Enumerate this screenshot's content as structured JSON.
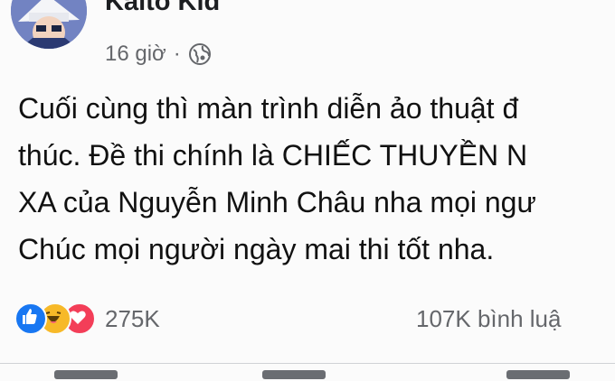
{
  "post": {
    "author": "Kaito Kid",
    "time": "16 giờ",
    "separator": "·",
    "privacy_icon": "globe-icon",
    "text_lines": [
      "Cuối cùng thì màn trình diễn ảo thuật đ",
      "thúc. Đề thi chính là CHIẾC THUYỀN N",
      "XA của Nguyễn Minh Châu nha mọi ngư",
      "Chúc mọi người ngày mai thi tốt nha."
    ]
  },
  "reactions": {
    "icons": [
      "like-icon",
      "haha-icon",
      "love-icon"
    ],
    "count": "275K"
  },
  "comments": {
    "label": "107K bình luậ"
  },
  "colors": {
    "like": "#1877f2",
    "haha": "#f7b928",
    "love": "#f33e58",
    "secondary_text": "#65676b"
  }
}
